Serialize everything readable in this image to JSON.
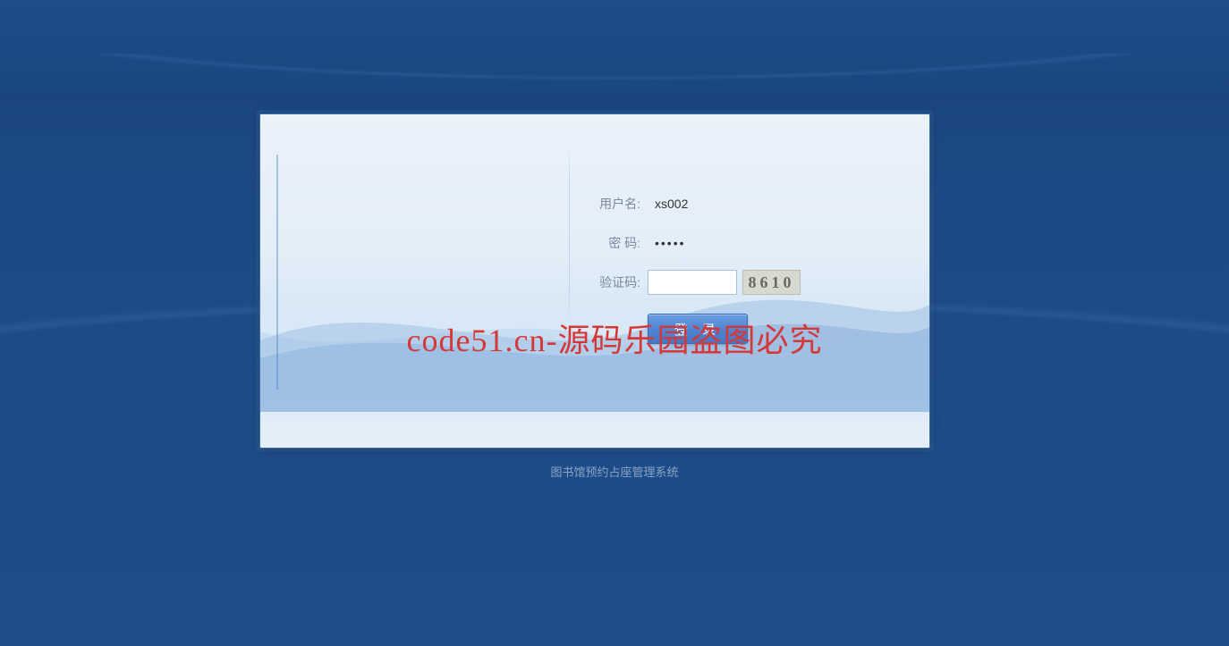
{
  "form": {
    "username_label": "用户名:",
    "password_label": "密  码:",
    "captcha_label": "验证码:",
    "username_value": "xs002",
    "password_value": "•••••",
    "captcha_value": "",
    "captcha_image": "8610",
    "login_button": "登 录"
  },
  "footer": "图书馆预约占座管理系统",
  "watermark": "code51.cn-源码乐园盗图必究"
}
